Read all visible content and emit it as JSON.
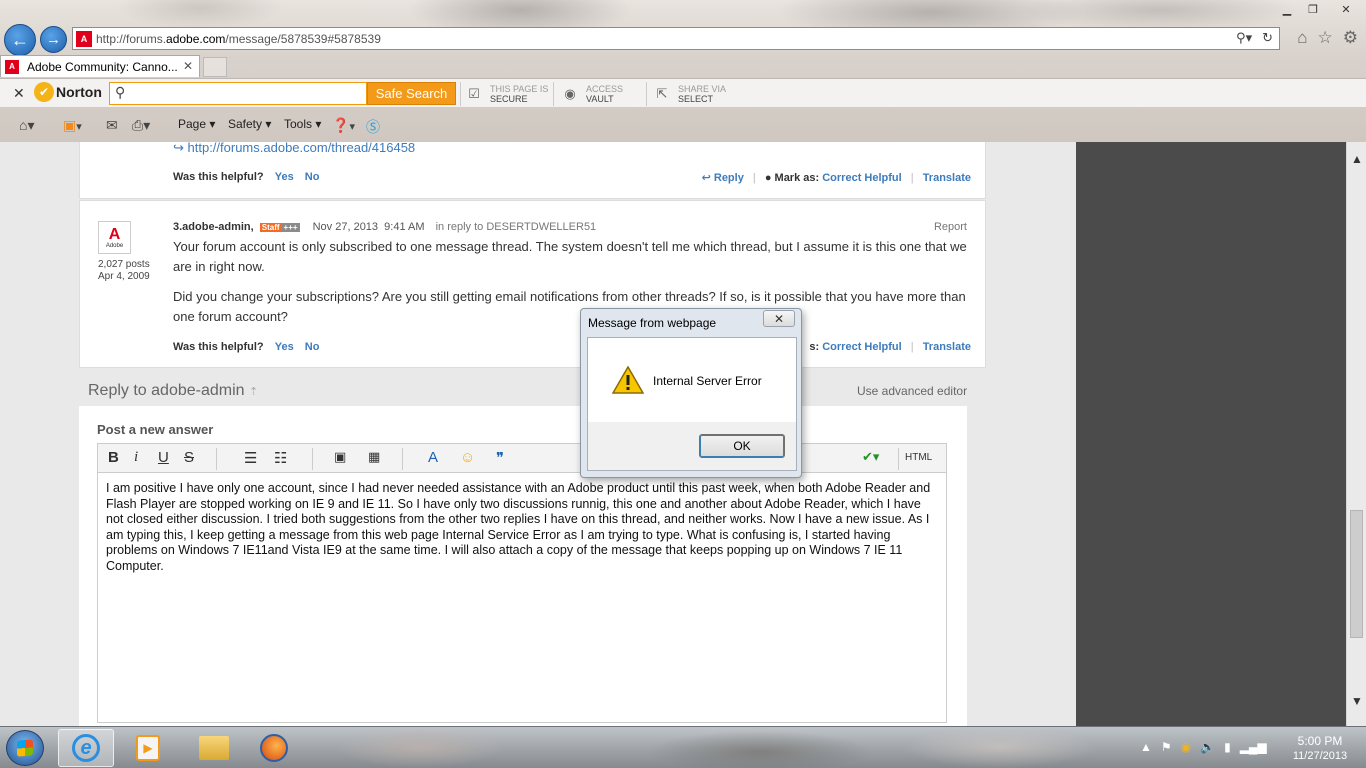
{
  "browser": {
    "address_url_prefix": "http://forums.",
    "address_url_domain": "adobe.com",
    "address_url_suffix": "/message/5878539#5878539",
    "tab_title": "Adobe Community: Canno...",
    "favicon_text": "A"
  },
  "norton": {
    "brand": "Norton",
    "search_placeholder": "",
    "safe_search_label": "Safe Search",
    "secure_line1": "THIS PAGE IS",
    "secure_line2": "SECURE",
    "vault_line1": "ACCESS",
    "vault_line2": "VAULT",
    "share_line1": "SHARE VIA",
    "share_line2": "SELECT"
  },
  "command_bar": {
    "page": "Page",
    "safety": "Safety",
    "tools": "Tools"
  },
  "thread": {
    "prev_message": {
      "link": "http://forums.adobe.com/thread/416458",
      "helpful_label": "Was this helpful?",
      "yes": "Yes",
      "no": "No",
      "reply": "Reply",
      "mark_as": "Mark as:",
      "correct": "Correct",
      "helpful": "Helpful",
      "translate": "Translate"
    },
    "message": {
      "avatar_letter": "A",
      "avatar_word": "Adobe",
      "posts": "2,027 posts",
      "joined": "Apr 4, 2009",
      "number_author": "3.adobe-admin,",
      "staff_badge": "Staff",
      "plus_badge": "+++",
      "date": "Nov 27, 2013",
      "time": "9:41 AM",
      "in_reply_to": "in reply to DESERTDWELLER51",
      "report": "Report",
      "para1": "Your forum account is only subscribed to one message thread. The system doesn't tell me which thread, but I assume it is this one that we are in right now.",
      "para2": "Did you change your subscriptions? Are you still getting email notifications from other threads? If so, is it possible that you have more than one forum account?",
      "helpful_label": "Was this helpful?",
      "yes": "Yes",
      "no": "No",
      "mark_suffix": "s:",
      "correct": "Correct",
      "helpful": "Helpful",
      "translate": "Translate"
    }
  },
  "reply": {
    "heading": "Reply to adobe-admin",
    "advanced_editor": "Use advanced editor",
    "post_new_answer": "Post a new answer",
    "html_label": "HTML",
    "body": "I am positive I have only one account, since I had never needed assistance with an Adobe product until this past week, when both Adobe Reader and Flash Player are stopped working on IE 9 and IE 11.  So I have only two discussions runnig, this one and another about Adobe Reader, which I have not closed either discussion.  I tried both suggestions from the other two replies I have on this thread, and neither works.  Now I have a new issue.  As I am typing this, I keep getting a message from this web page Internal Service Error as I am trying to type.  What is confusing is, I started having problems on Windows 7 IE11and Vista IE9 at the same time.  I will also attach a copy of the message that keeps popping up on Windows 7 IE 11 Computer."
  },
  "dialog": {
    "title": "Message from webpage",
    "message": "Internal Server Error",
    "ok": "OK"
  },
  "taskbar": {
    "time": "5:00 PM",
    "date": "11/27/2013"
  },
  "icons": [
    "back-arrow-icon",
    "forward-arrow-icon",
    "search-icon",
    "refresh-icon",
    "home-icon",
    "favorites-star-icon",
    "settings-gear-icon",
    "warning-icon",
    "windows-start-icon"
  ]
}
